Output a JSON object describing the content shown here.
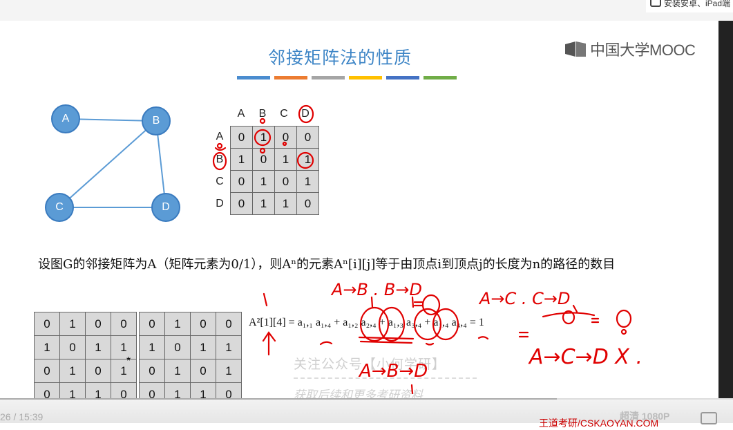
{
  "topbar": {
    "tip": "安装安卓、iPad端"
  },
  "slide": {
    "title": "邻接矩阵法的性质",
    "stripe_colors": [
      "#4a8ccf",
      "#ec7c31",
      "#a5a5a5",
      "#ffc000",
      "#4472c4",
      "#70ad47"
    ],
    "logo_text": "中国大学MOOC",
    "graph_nodes": [
      "A",
      "B",
      "C",
      "D"
    ],
    "col_headers": [
      "A",
      "B",
      "C",
      "D"
    ],
    "row_headers": [
      "A",
      "B",
      "C",
      "D"
    ],
    "adjacency": [
      [
        "0",
        "1",
        "0",
        "0"
      ],
      [
        "1",
        "0",
        "1",
        "1"
      ],
      [
        "0",
        "1",
        "0",
        "1"
      ],
      [
        "0",
        "1",
        "1",
        "0"
      ]
    ],
    "sentence": "设图G的邻接矩阵为A（矩阵元素为0/1），则Aⁿ的元素Aⁿ[i][j]等于由顶点i到顶点j的长度为n的路径的数目",
    "left_matrix": [
      [
        "0",
        "1",
        "0",
        "0"
      ],
      [
        "1",
        "0",
        "1",
        "1"
      ],
      [
        "0",
        "1",
        "0",
        "1"
      ],
      [
        "0",
        "1",
        "1",
        "0"
      ]
    ],
    "right_matrix": [
      [
        "0",
        "1",
        "0",
        "0"
      ],
      [
        "1",
        "0",
        "1",
        "1"
      ],
      [
        "0",
        "1",
        "0",
        "1"
      ],
      [
        "0",
        "1",
        "1",
        "0"
      ]
    ],
    "multiply": "*",
    "formula": {
      "lhs": "A²[1][4] = ",
      "terms": [
        "a₁,₁ a₁,₄ + ",
        "a₁,₂ a₂,₄ + ",
        "a₁,₃ a₃,₄ + ",
        "a₁,₄ a₄,₄ "
      ],
      "rhs": "= 1"
    }
  },
  "handwriting": {
    "ab_bd": "A→B . B→D",
    "ac_cd": "A→C . C→D",
    "abd": "A→B→D",
    "acd": "A→C→D  X ."
  },
  "watermark": {
    "line1": "关注公众号【小何学研】",
    "line2": "获取后续和更多考研资料"
  },
  "player": {
    "time": "26 / 15:39",
    "quality": "超清 1080P",
    "author": "王道考研/CSKAOYAN.COM",
    "progress": 0.76
  }
}
